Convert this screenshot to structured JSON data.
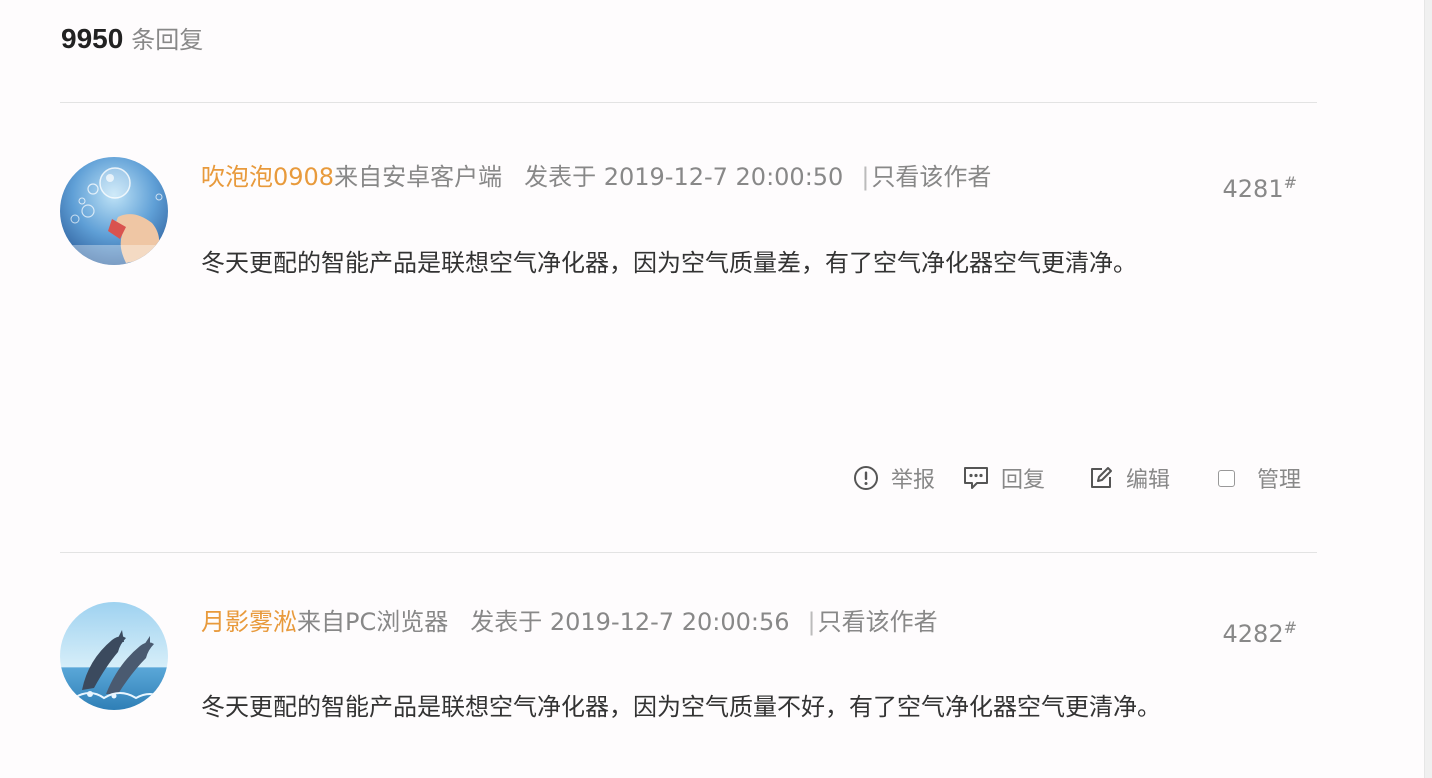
{
  "header": {
    "reply_count": "9950",
    "reply_suffix": "条回复"
  },
  "posts": [
    {
      "username": "吹泡泡0908",
      "source": "来自安卓客户端",
      "posted": "发表于 2019-12-7 20:00:50",
      "separator": "|",
      "only_author": "只看该作者",
      "floor_number": "4281",
      "floor_mark": "#",
      "content": "冬天更配的智能产品是联想空气净化器，因为空气质量差，有了空气净化器空气更清净。",
      "avatar_icon": "bubble-avatar-icon"
    },
    {
      "username": "月影雾淞",
      "source": "来自PC浏览器",
      "posted": "发表于 2019-12-7 20:00:56",
      "separator": "|",
      "only_author": "只看该作者",
      "floor_number": "4282",
      "floor_mark": "#",
      "content": "冬天更配的智能产品是联想空气净化器，因为空气质量不好，有了空气净化器空气更清净。",
      "avatar_icon": "dolphin-avatar-icon"
    }
  ],
  "actions": {
    "report_label": "举报",
    "reply_label": "回复",
    "edit_label": "编辑",
    "manage_label": "管理",
    "report_icon": "exclamation-circle-icon",
    "reply_icon": "comment-icon",
    "edit_icon": "pencil-square-icon",
    "manage_icon": "checkbox-icon"
  },
  "colors": {
    "username": "#e89a3c",
    "muted": "#888888",
    "text": "#333333",
    "divider": "#e3e3e3",
    "background": "#fefcfd"
  }
}
